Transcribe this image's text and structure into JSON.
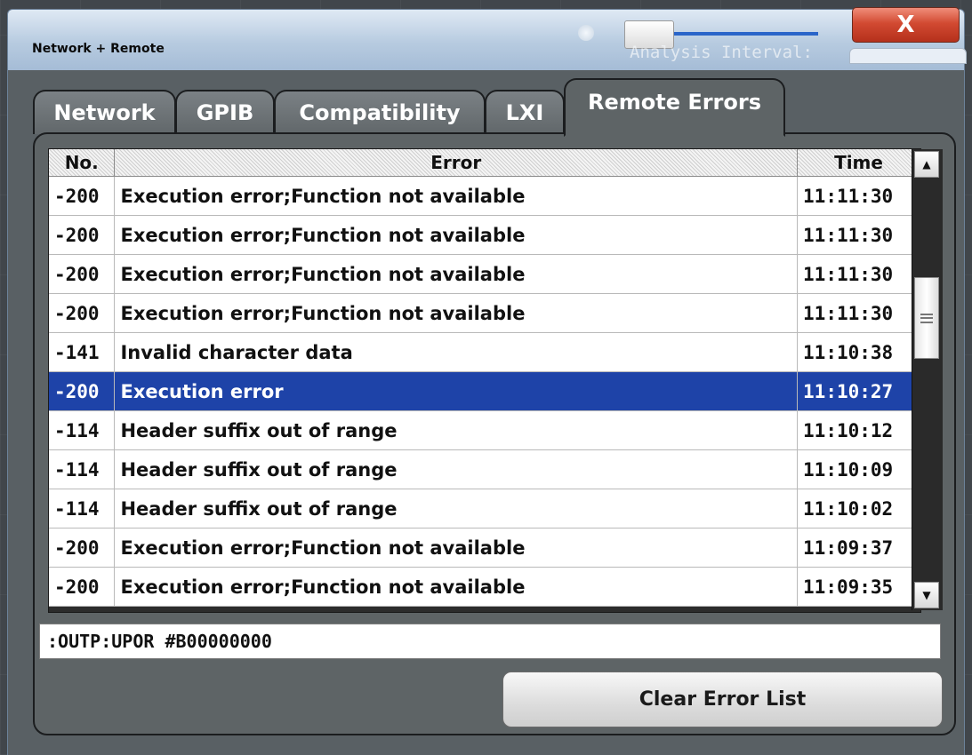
{
  "window": {
    "title": "Network + Remote",
    "close_label": "X",
    "background_text": "Analysis Interval:"
  },
  "tabs": [
    {
      "label": "Network",
      "active": false
    },
    {
      "label": "GPIB",
      "active": false
    },
    {
      "label": "Compatibility",
      "active": false
    },
    {
      "label": "LXI",
      "active": false
    },
    {
      "label": "Remote Errors",
      "active": true
    }
  ],
  "error_table": {
    "headers": {
      "no": "No.",
      "error": "Error",
      "time": "Time"
    },
    "rows": [
      {
        "no": "-200",
        "error": "Execution error;Function not available",
        "time": "11:11:30"
      },
      {
        "no": "-200",
        "error": "Execution error;Function not available",
        "time": "11:11:30"
      },
      {
        "no": "-200",
        "error": "Execution error;Function not available",
        "time": "11:11:30"
      },
      {
        "no": "-200",
        "error": "Execution error;Function not available",
        "time": "11:11:30"
      },
      {
        "no": "-141",
        "error": "Invalid character data",
        "time": "11:10:38"
      },
      {
        "no": "-200",
        "error": "Execution error",
        "time": "11:10:27",
        "selected": true
      },
      {
        "no": "-114",
        "error": "Header suffix out of range",
        "time": "11:10:12"
      },
      {
        "no": "-114",
        "error": "Header suffix out of range",
        "time": "11:10:09"
      },
      {
        "no": "-114",
        "error": "Header suffix out of range",
        "time": "11:10:02"
      },
      {
        "no": "-200",
        "error": "Execution error;Function not available",
        "time": "11:09:37"
      },
      {
        "no": "-200",
        "error": "Execution error;Function not available",
        "time": "11:09:35"
      }
    ]
  },
  "command_line": ":OUTP:UPOR #B00000000",
  "buttons": {
    "clear_error_list": "Clear Error List"
  },
  "icons": {
    "close": "close-icon",
    "scroll_up": "arrow-up-icon",
    "scroll_down": "arrow-down-icon",
    "scroll_grip": "grip-icon"
  },
  "colors": {
    "selected_row": "#1e43a8",
    "close_button": "#d24a32",
    "panel": "#5e6466"
  }
}
